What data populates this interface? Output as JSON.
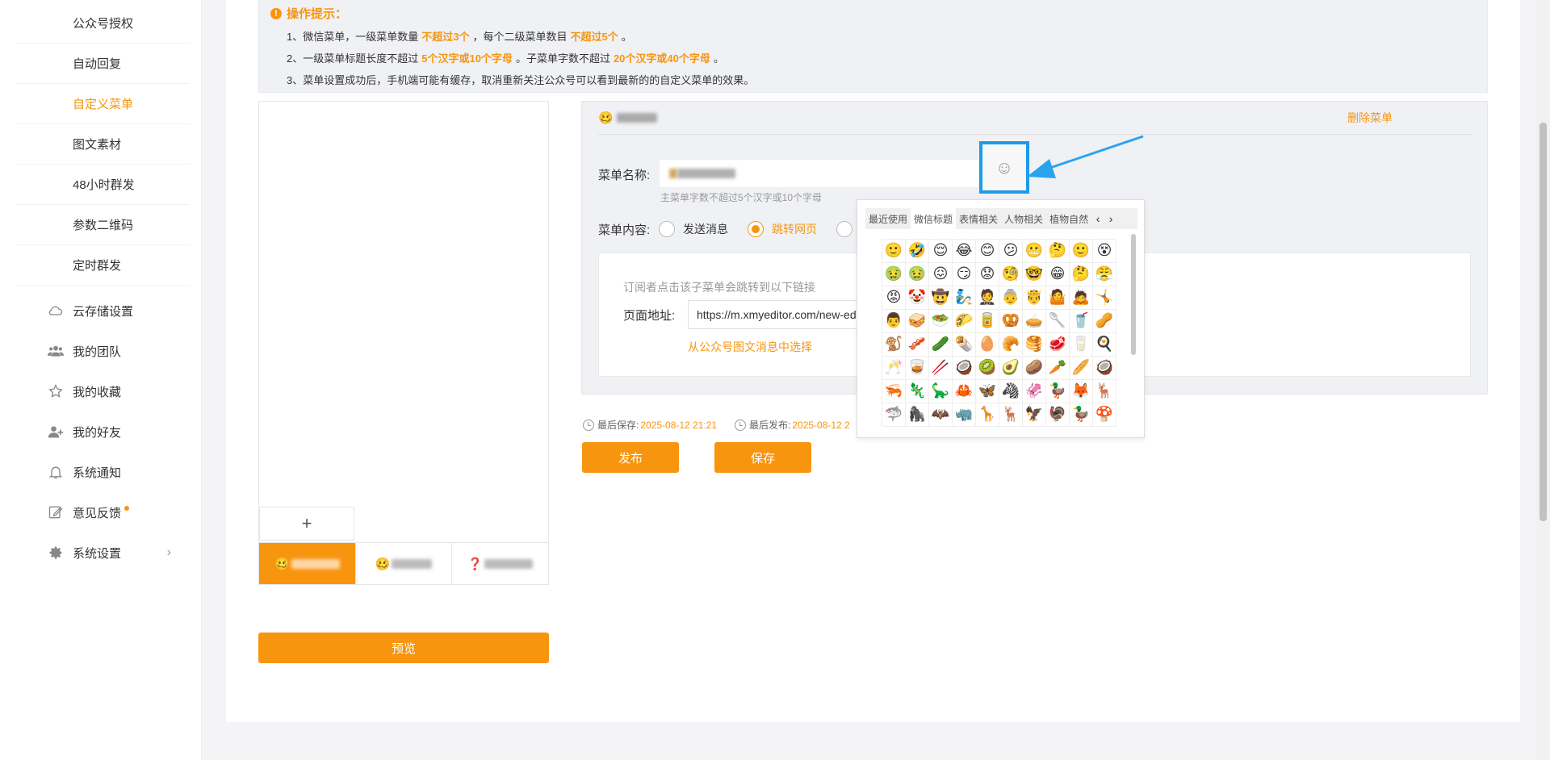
{
  "sidebar": {
    "sub_items": [
      {
        "label": "公众号授权"
      },
      {
        "label": "自动回复"
      },
      {
        "label": "自定义菜单"
      },
      {
        "label": "图文素材"
      },
      {
        "label": "48小时群发"
      },
      {
        "label": "参数二维码"
      },
      {
        "label": "定时群发"
      }
    ],
    "nav_items": [
      {
        "label": "云存储设置",
        "icon": "cloud-icon"
      },
      {
        "label": "我的团队",
        "icon": "team-icon"
      },
      {
        "label": "我的收藏",
        "icon": "star-icon"
      },
      {
        "label": "我的好友",
        "icon": "add-friend-icon"
      },
      {
        "label": "系统通知",
        "icon": "bell-icon"
      },
      {
        "label": "意见反馈",
        "icon": "edit-icon"
      },
      {
        "label": "系统设置",
        "icon": "gear-icon",
        "chevron": "›"
      }
    ]
  },
  "tips": {
    "title": "操作提示：",
    "line1_a": "1、微信菜单，一级菜单数量",
    "line1_b": "不超过3个",
    "line1_c": "，每个二级菜单数目",
    "line1_d": "不超过5个",
    "line1_e": "。",
    "line2_a": "2、一级菜单标题长度不超过",
    "line2_b": "5个汉字或10个字母",
    "line2_c": "。子菜单字数不超过",
    "line2_d": "20个汉字或40个字母",
    "line2_e": "。",
    "line3": "3、菜单设置成功后，手机端可能有缓存，取消重新关注公众号可以看到最新的的自定义菜单的效果。"
  },
  "phone": {
    "add_label": "+",
    "menu": [
      {
        "emoji": "🥴"
      },
      {
        "emoji": "🥴"
      },
      {
        "emoji": "❓"
      }
    ]
  },
  "preview_label": "预览",
  "editor": {
    "header_emoji": "🥴",
    "delete_label": "删除菜单",
    "name_label": "菜单名称:",
    "emoji_button": "☺",
    "name_hint": "主菜单字数不超过5个汉字或10个字母",
    "content_label": "菜单内容:",
    "radio_send": "发送消息",
    "radio_jump": "跳转网页",
    "link_tip": "订阅者点击该子菜单会跳转到以下链接",
    "url_label": "页面地址:",
    "url_value": "https://m.xmyeditor.com/new-ed",
    "pick_link": "从公众号图文消息中选择",
    "last_save_label": "最后保存:",
    "last_save_value": "2025-08-12 21:21",
    "last_publish_label": "最后发布:",
    "last_publish_value": "2025-08-12 2"
  },
  "buttons": {
    "publish": "发布",
    "save": "保存"
  },
  "picker": {
    "tabs": [
      "最近使用",
      "微信标题",
      "表情相关",
      "人物相关",
      "植物自然"
    ],
    "active_tab": 1,
    "prev": "‹",
    "next": "›",
    "emojis": [
      "🙂",
      "🤣",
      "😌",
      "😂",
      "😊",
      "😕",
      "😬",
      "🤔",
      "🙂",
      "😵",
      "🤢",
      "🤢",
      "😖",
      "😏",
      "😟",
      "🧐",
      "🤓",
      "😁",
      "🤔",
      "😤",
      "😡",
      "🤡",
      "🤠",
      "🧞",
      "🤵",
      "👵",
      "🤴",
      "🤷",
      "🙇",
      "🤸",
      "👨",
      "🥪",
      "🥗",
      "🌮",
      "🥫",
      "🥨",
      "🥧",
      "🥄",
      "🥤",
      "🥜",
      "🐒",
      "🥓",
      "🥒",
      "🌯",
      "🥚",
      "🥐",
      "🥞",
      "🥩",
      "🥛",
      "🍳",
      "🥂",
      "🥃",
      "🥢",
      "🥥",
      "🥝",
      "🥑",
      "🥔",
      "🥕",
      "🥖",
      "🥥",
      "🦐",
      "🦎",
      "🦕",
      "🦀",
      "🦋",
      "🦓",
      "🦑",
      "🦆",
      "🦊",
      "🦌",
      "🦈",
      "🦍",
      "🦇",
      "🦏",
      "🦒",
      "🦌",
      "🦅",
      "🦃",
      "🦆",
      "🍄"
    ]
  }
}
